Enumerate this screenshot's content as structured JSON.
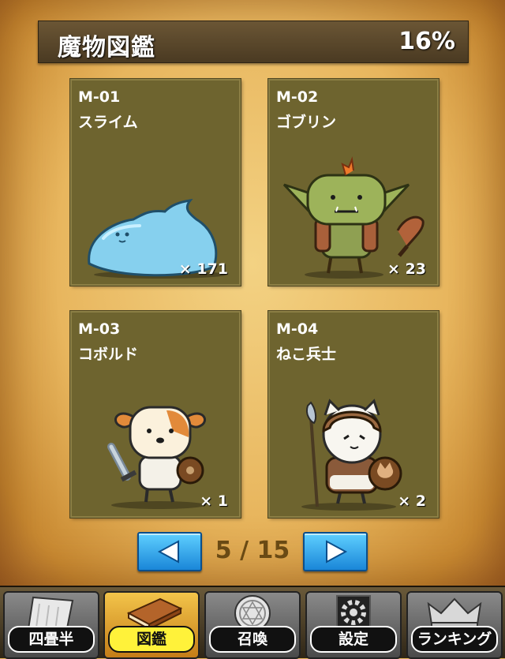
{
  "header": {
    "title": "魔物図鑑",
    "progress": "16%"
  },
  "cards": [
    {
      "id": "M-01",
      "name": "スライム",
      "count": "× 171",
      "icon": "slime"
    },
    {
      "id": "M-02",
      "name": "ゴブリン",
      "count": "× 23",
      "icon": "goblin"
    },
    {
      "id": "M-03",
      "name": "コボルド",
      "count": "× 1",
      "icon": "kobold"
    },
    {
      "id": "M-04",
      "name": "ねこ兵士",
      "count": "× 2",
      "icon": "cat-soldier"
    }
  ],
  "pager": {
    "page": "5 / 15",
    "prev_icon": "left-arrow-icon",
    "next_icon": "right-arrow-icon"
  },
  "tabs": [
    {
      "label": "四畳半",
      "icon": "tatami-icon",
      "active": false
    },
    {
      "label": "図鑑",
      "icon": "book-icon",
      "active": true
    },
    {
      "label": "召喚",
      "icon": "summon-circle-icon",
      "active": false
    },
    {
      "label": "設定",
      "icon": "gear-icon",
      "active": false
    },
    {
      "label": "ランキング",
      "icon": "crown-icon",
      "active": false
    }
  ],
  "colors": {
    "accent_blue": "#1a86d8",
    "active_tab": "#fff23a",
    "card_bg": "#6e642f"
  }
}
